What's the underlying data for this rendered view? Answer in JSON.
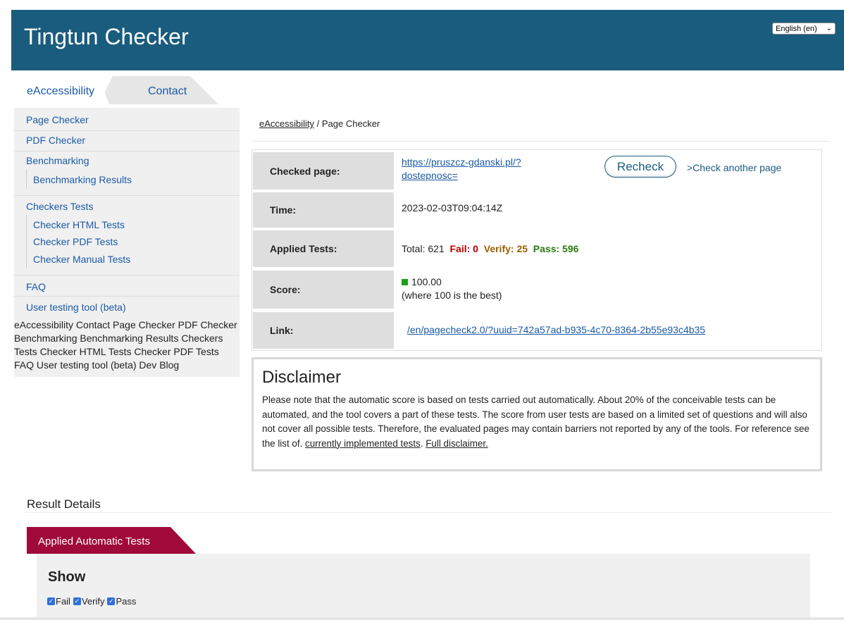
{
  "header": {
    "app_title": "Tingtun Checker",
    "language": "English (en)"
  },
  "tabs": [
    {
      "label": "eAccessibility",
      "active": true
    },
    {
      "label": "Contact",
      "active": false
    }
  ],
  "sidebar": {
    "page_checker": "Page Checker",
    "pdf_checker": "PDF Checker",
    "benchmarking": "Benchmarking",
    "benchmarking_results": "Benchmarking Results",
    "checkers_tests": "Checkers Tests",
    "checker_html_tests": "Checker HTML Tests",
    "checker_pdf_tests": "Checker PDF Tests",
    "checker_manual_tests": "Checker Manual Tests",
    "faq": "FAQ",
    "user_testing_tool": "User testing tool (beta)",
    "text_fallback": "eAccessibility Contact Page Checker PDF Checker Benchmarking Benchmarking Results Checkers Tests Checker HTML Tests Checker PDF Tests FAQ User testing tool (beta) Dev Blog"
  },
  "breadcrumb": {
    "root": "eAccessibility",
    "separator": " / ",
    "current": "Page Checker"
  },
  "info": {
    "checked_page_label": "Checked page:",
    "checked_page_url_line1": "https://pruszcz-gdanski.pl/?",
    "checked_page_url_line2": "dostepnosc=",
    "recheck_label": "Recheck",
    "check_another_label": ">Check another page",
    "time_label": "Time:",
    "time_value": "2023-02-03T09:04:14Z",
    "applied_tests_label": "Applied Tests:",
    "total": "Total: 621",
    "fail": "Fail: 0",
    "verify": "Verify: 25",
    "pass": "Pass: 596",
    "score_label": "Score:",
    "score_value": "100.00",
    "score_note": "(where 100 is the best)",
    "link_label": "Link:",
    "link_value": "/en/pagecheck2.0/?uuid=742a57ad-b935-4c70-8364-2b55e93c4b35"
  },
  "disclaimer": {
    "title": "Disclaimer",
    "text": "Please note that the automatic score is based on tests carried out automatically. About 20% of the conceivable tests can be automated, and the tool covers a part of these tests. The score from user tests are based on a limited set of questions and will also not cover all possible tests. Therefore, the evaluated pages may contain barriers not reported by any of the tools. For reference see the list of. ",
    "tests_link": "currently implemented tests",
    "sep": ". ",
    "full_link": "Full disclaimer."
  },
  "results": {
    "title": "Result Details",
    "tab_label": "Applied Automatic Tests",
    "show_title": "Show",
    "filters": [
      {
        "label": "Fail",
        "checked": true
      },
      {
        "label": "Verify",
        "checked": true
      },
      {
        "label": "Pass",
        "checked": true
      }
    ]
  },
  "colors": {
    "header_bg": "#1a5c7e",
    "tab_red": "#a00a3a",
    "fail": "#b00000",
    "verify": "#996000",
    "pass": "#2a7a10",
    "score_square": "#1aa01a"
  }
}
